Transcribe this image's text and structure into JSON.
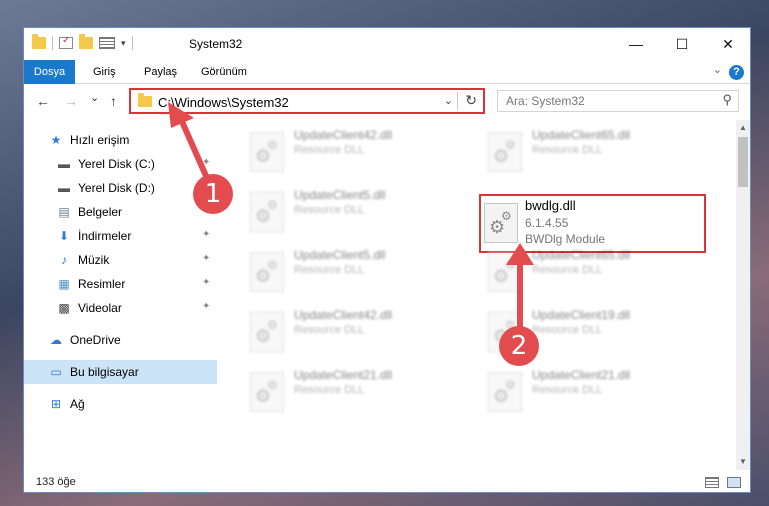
{
  "window": {
    "title": "System32",
    "controls": {
      "minimize": "—",
      "maximize": "☐",
      "close": "✕"
    }
  },
  "ribbon": {
    "tabs": [
      "Dosya",
      "Giriş",
      "Paylaş",
      "Görünüm"
    ],
    "help_label": "?"
  },
  "nav": {
    "back": "←",
    "forward": "→",
    "recent": "⌄",
    "up": "↑",
    "address": "C:\\Windows\\System32",
    "search_placeholder": "Ara: System32"
  },
  "sidebar": {
    "items": [
      {
        "label": "Hızlı erişim",
        "icon": "star-icon",
        "glyph": "★",
        "color": "#2f7ad6",
        "pinned": false
      },
      {
        "label": "Yerel Disk (C:)",
        "icon": "drive-icon",
        "glyph": "▬",
        "color": "#555555",
        "pinned": true
      },
      {
        "label": "Yerel Disk (D:)",
        "icon": "drive-icon",
        "glyph": "▬",
        "color": "#555555",
        "pinned": true
      },
      {
        "label": "Belgeler",
        "icon": "documents-icon",
        "glyph": "▤",
        "color": "#6c7a8a",
        "pinned": true
      },
      {
        "label": "İndirmeler",
        "icon": "downloads-icon",
        "glyph": "⬇",
        "color": "#2f7ad6",
        "pinned": true
      },
      {
        "label": "Müzik",
        "icon": "music-icon",
        "glyph": "♪",
        "color": "#2f7ad6",
        "pinned": true
      },
      {
        "label": "Resimler",
        "icon": "pictures-icon",
        "glyph": "▦",
        "color": "#4a90c8",
        "pinned": true
      },
      {
        "label": "Videolar",
        "icon": "videos-icon",
        "glyph": "▩",
        "color": "#444444",
        "pinned": true
      },
      {
        "label": "OneDrive",
        "icon": "cloud-icon",
        "glyph": "☁",
        "color": "#2f7ad6",
        "pinned": false
      },
      {
        "label": "Bu bilgisayar",
        "icon": "computer-icon",
        "glyph": "▭",
        "color": "#2f7ad6",
        "pinned": false,
        "selected": true
      },
      {
        "label": "Ağ",
        "icon": "network-icon",
        "glyph": "⊞",
        "color": "#2f7ad6",
        "pinned": false
      }
    ]
  },
  "files": {
    "blurred": [
      {
        "name": "UpdateClient42.dll",
        "type": "Resource DLL"
      },
      {
        "name": "UpdateClient65.dll",
        "type": "Resource DLL"
      },
      {
        "name": "UpdateClient5.dll",
        "type": "Resource DLL"
      },
      {
        "name": "UpdateClient5.dll",
        "type": "Resource DLL"
      },
      {
        "name": "UpdateClient65.dll",
        "type": "Resource DLL"
      },
      {
        "name": "UpdateClient42.dll",
        "type": "Resource DLL"
      },
      {
        "name": "UpdateClient19.dll",
        "type": "Resource DLL"
      },
      {
        "name": "UpdateClient21.dll",
        "type": "Resource DLL"
      },
      {
        "name": "UpdateClient21.dll",
        "type": "Resource DLL"
      }
    ],
    "highlighted": {
      "name": "bwdlg.dll",
      "version": "6.1.4.55",
      "description": "BWDlg Module"
    }
  },
  "status": {
    "item_count": "133 öğe"
  },
  "annotations": {
    "step1": "1",
    "step2": "2",
    "accent": "#e24c4f"
  }
}
